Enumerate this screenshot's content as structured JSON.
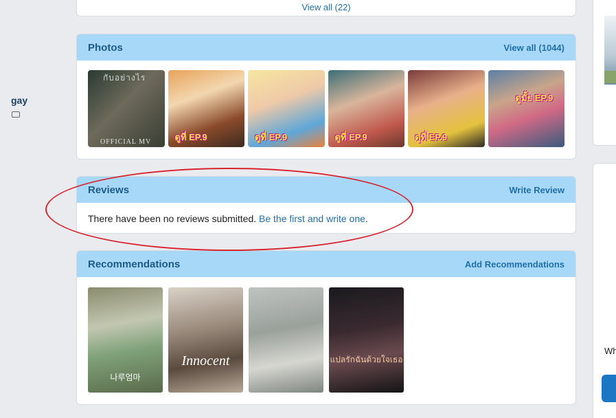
{
  "top_card": {
    "view_all": "View all (22)"
  },
  "photos": {
    "title": "Photos",
    "view_all": "View all (1044)",
    "items": [
      {
        "top_text": "กับอย่างไร",
        "mv": "OFFICIAL MV"
      },
      {
        "tag": "ดูที่ EP.9"
      },
      {
        "tag": "ดูที่ EP.9"
      },
      {
        "tag": "ดูที่ EP.9"
      },
      {
        "tag": "ดูที่ EP.9"
      },
      {
        "tag": "ดูมั้ย EP.9"
      }
    ]
  },
  "reviews": {
    "title": "Reviews",
    "write_review": "Write Review",
    "empty_text": "There have been no reviews submitted. ",
    "empty_link": "Be the first and write one",
    "empty_end": "."
  },
  "recommendations": {
    "title": "Recommendations",
    "add": "Add Recommendations",
    "items": [
      {
        "caption": "나루엄마"
      },
      {
        "caption": "Innocent"
      },
      {
        "caption": ""
      },
      {
        "caption": "แปลรักฉันด้วยใจเธอ"
      }
    ]
  },
  "sidebar": {
    "name_fragment": "gay",
    "text_fragment": "Wh"
  }
}
